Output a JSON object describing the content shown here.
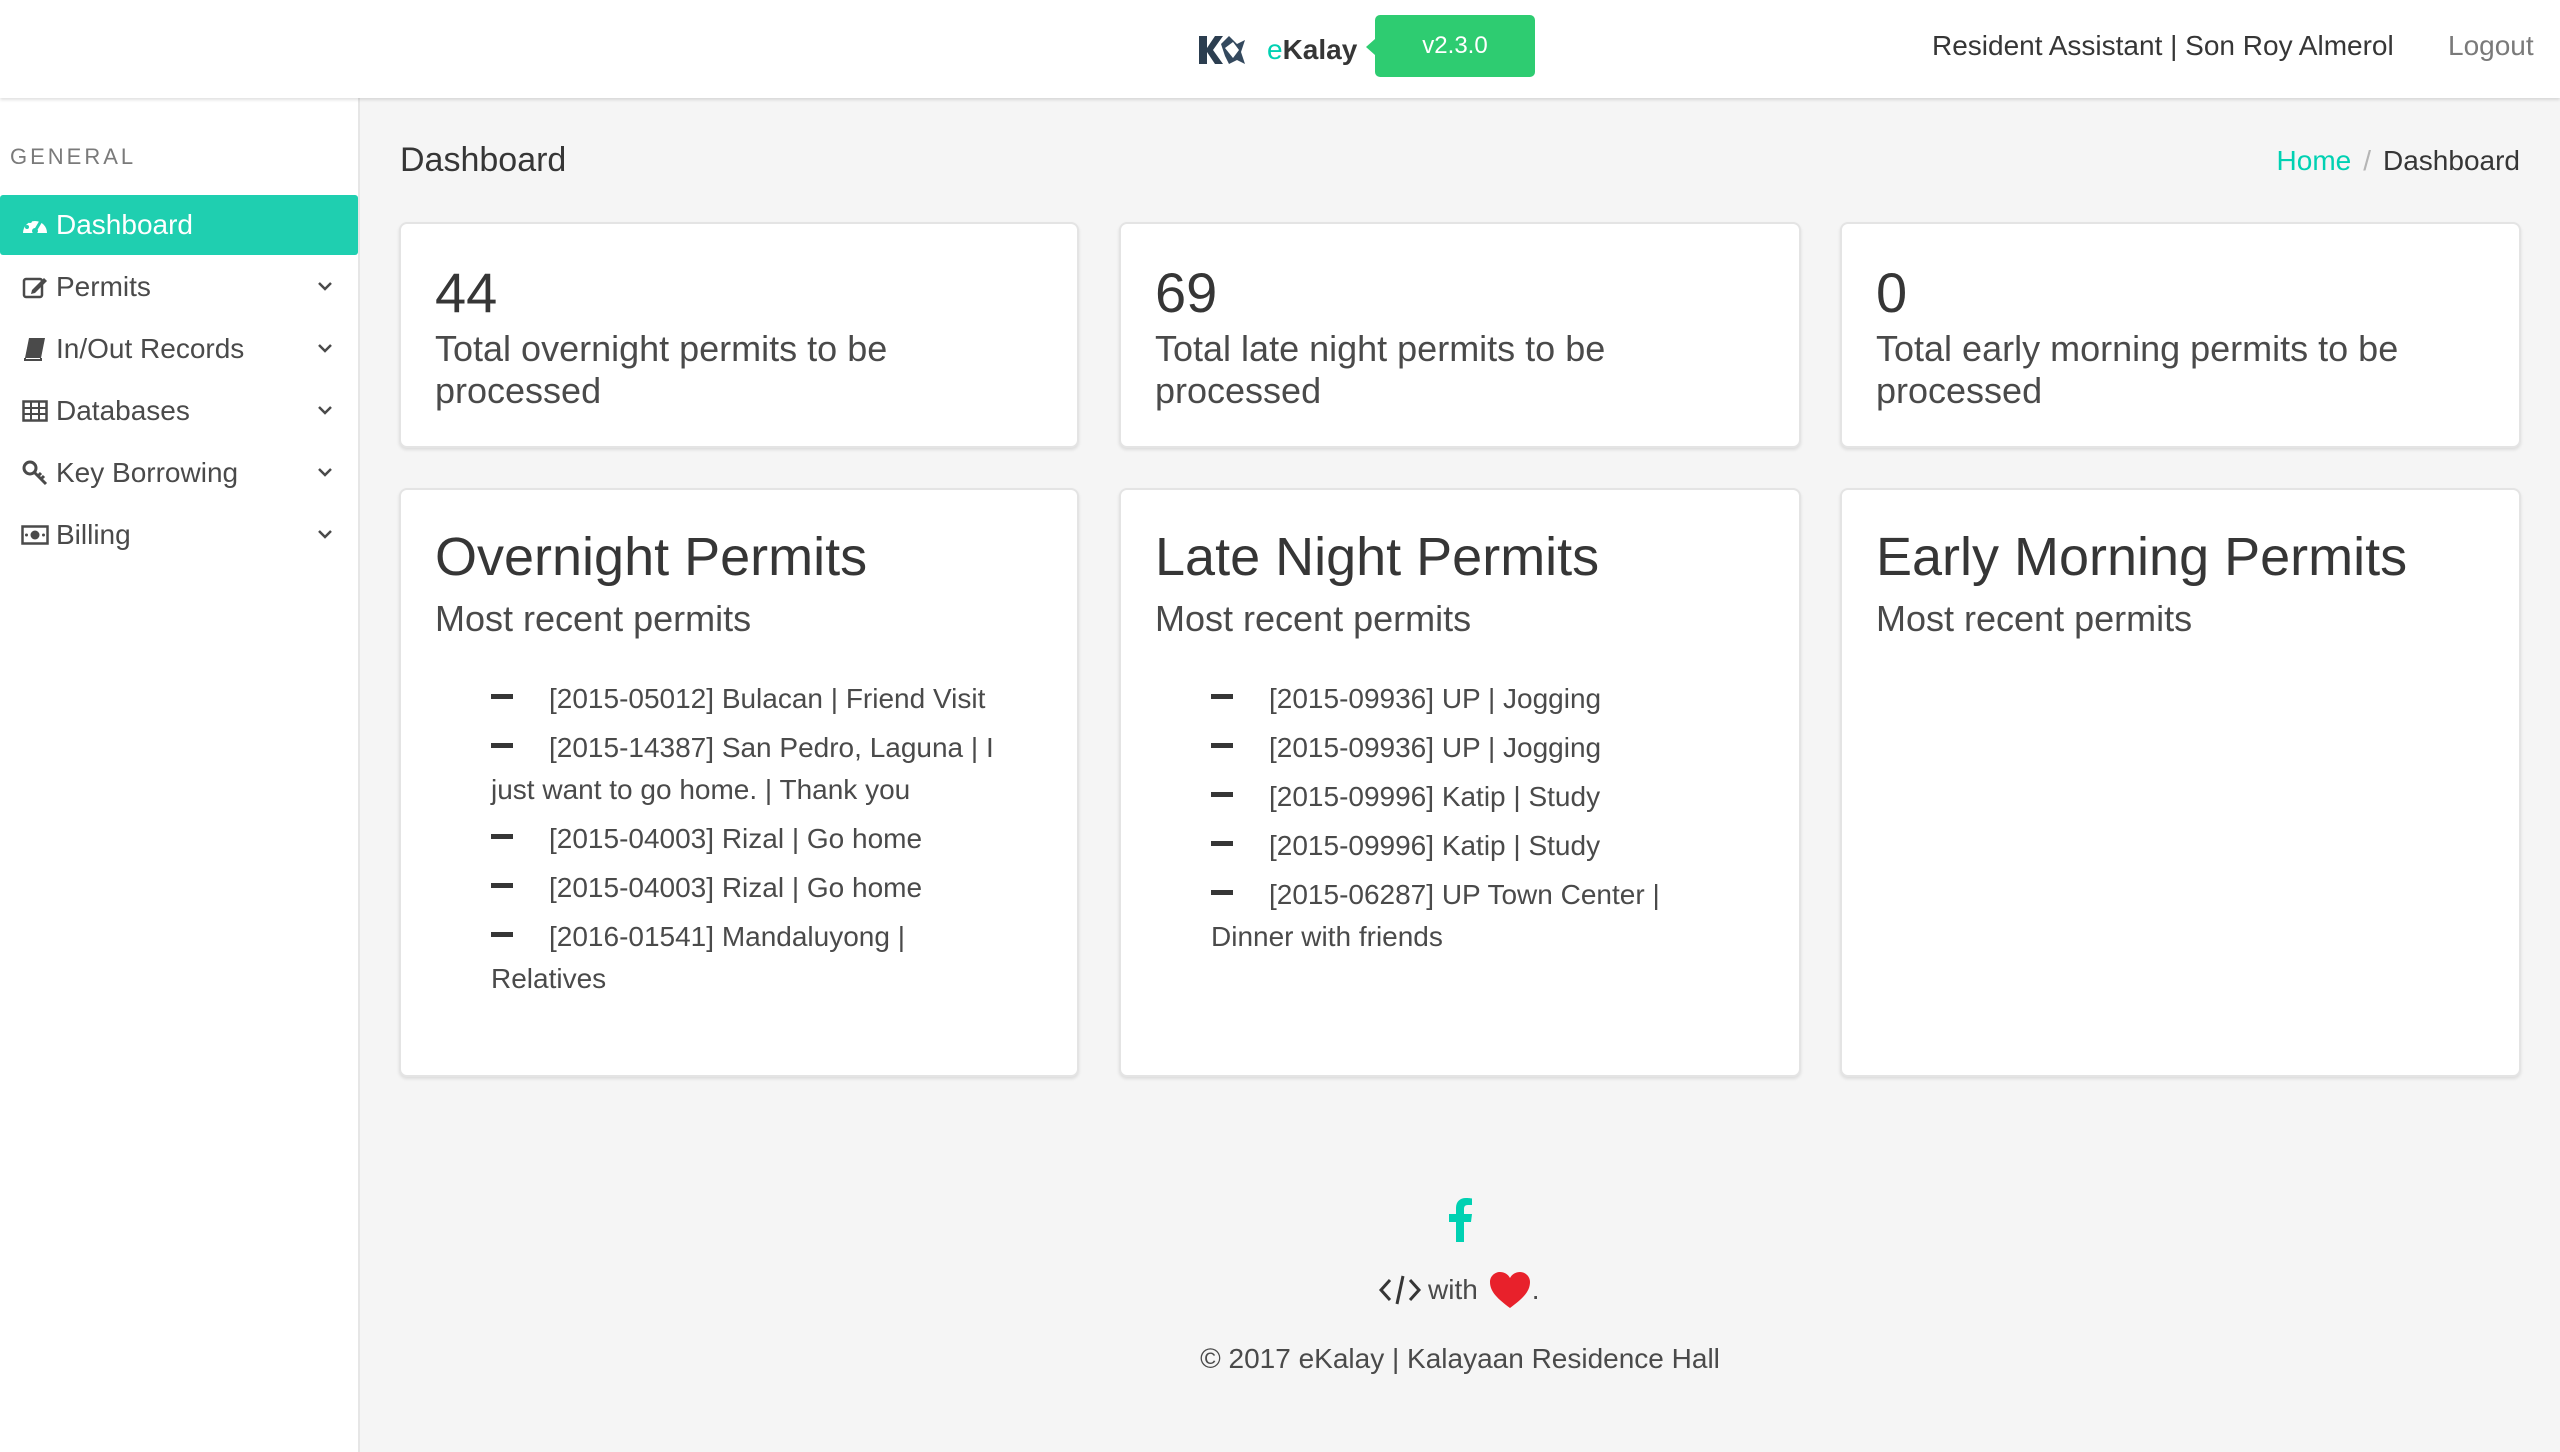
{
  "navbar": {
    "brand_prefix": "e",
    "brand_rest": "Kalay",
    "version": "v2.3.0",
    "user": "Resident Assistant | Son Roy Almerol",
    "logout": "Logout"
  },
  "sidebar": {
    "label": "GENERAL",
    "items": [
      {
        "label": "Dashboard",
        "icon": "dashboard-icon"
      },
      {
        "label": "Permits",
        "icon": "edit-icon"
      },
      {
        "label": "In/Out Records",
        "icon": "book-icon"
      },
      {
        "label": "Databases",
        "icon": "table-icon"
      },
      {
        "label": "Key Borrowing",
        "icon": "key-icon"
      },
      {
        "label": "Billing",
        "icon": "money-icon"
      }
    ]
  },
  "header": {
    "title": "Dashboard",
    "breadcrumb_home": "Home",
    "breadcrumb_sep": "/",
    "breadcrumb_current": "Dashboard"
  },
  "stats": [
    {
      "value": "44",
      "text": "Total overnight permits to be processed"
    },
    {
      "value": "69",
      "text": "Total late night permits to be processed"
    },
    {
      "value": "0",
      "text": "Total early morning permits to be processed"
    }
  ],
  "permits": [
    {
      "title": "Overnight Permits",
      "subtitle": "Most recent permits",
      "items": [
        "[2015-05012] Bulacan | Friend Visit",
        "[2015-14387] San Pedro, Laguna | I just want to go home. | Thank you",
        "[2015-04003] Rizal | Go home",
        "[2015-04003] Rizal | Go home",
        "[2016-01541] Mandaluyong | Relatives"
      ]
    },
    {
      "title": "Late Night Permits",
      "subtitle": "Most recent permits",
      "items": [
        "[2015-09936] UP | Jogging",
        "[2015-09936] UP | Jogging",
        "[2015-09996] Katip | Study",
        "[2015-09996] Katip | Study",
        "[2015-06287] UP Town Center | Dinner with friends"
      ]
    },
    {
      "title": "Early Morning Permits",
      "subtitle": "Most recent permits",
      "items": []
    }
  ],
  "footer": {
    "made_with": "with",
    "period": ".",
    "copyright": "© 2017 eKalay | Kalayaan Residence Hall"
  },
  "colors": {
    "accent": "#00d1b2",
    "version_tag": "#2ecc71",
    "heart": "#e8212b"
  }
}
